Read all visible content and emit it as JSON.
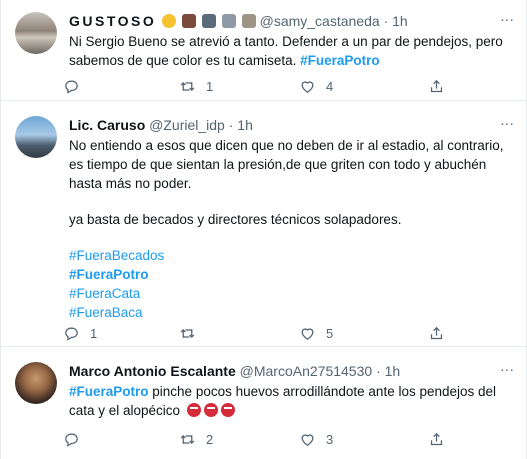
{
  "tweets": [
    {
      "name": "GUSTOSO",
      "handle": "@samy_castaneda",
      "separator": "·",
      "time": "1h",
      "icons": [
        "smile-face-emoji",
        "train-emoji",
        "atm-emoji",
        "chart-emoji",
        "castle-emoji"
      ],
      "text": "Ni Sergio Bueno se atrevió a tanto. Defender a un par de pendejos, pero sabemos de que color es tu camiseta. ",
      "hashtag": "#FueraPotro",
      "replies": "",
      "retweets": "1",
      "likes": "4"
    },
    {
      "name": "Lic. Caruso",
      "handle": "@Zuriel_idp",
      "separator": "·",
      "time": "1h",
      "text_line1": "No entiendo a esos que dicen que no deben de ir al estadio, al contrario, es tiempo de que sientan la presión,de que griten con todo y abuchén hasta más no poder.",
      "text_line2": "ya basta de becados y directores técnicos solapadores.",
      "hashtags": [
        "#FueraBecados",
        "#FueraPotro",
        "#FueraCata",
        "#FueraBaca"
      ],
      "replies": "1",
      "retweets": "",
      "likes": "5"
    },
    {
      "name": "Marco Antonio Escalante",
      "handle": "@MarcoAn27514530",
      "separator": "·",
      "time": "1h",
      "hashtag": "#FueraPotro",
      "text": " pinche pocos huevos arrodillándote ante los pendejos del cata y el alopécico",
      "emoji": [
        "angry-face-emoji",
        "angry-face-emoji",
        "angry-face-emoji"
      ],
      "replies": "",
      "retweets": "2",
      "likes": "3"
    }
  ],
  "more_label": "···",
  "colors": {
    "link": "#1d9bf0",
    "muted": "#536471",
    "border": "#e6ecf0",
    "text": "#0f1419"
  }
}
